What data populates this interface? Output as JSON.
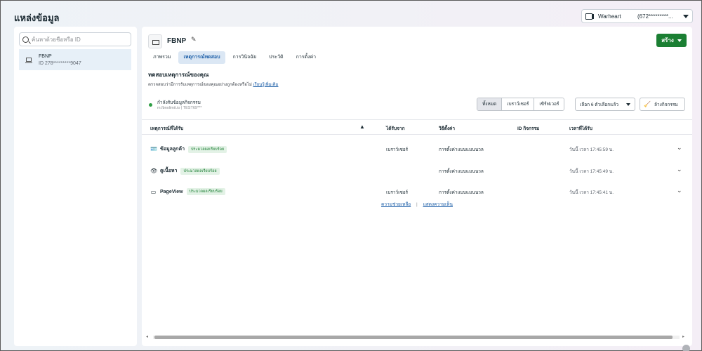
{
  "header": {
    "title": "แหล่งข้อมูล",
    "account": {
      "name": "Warheart",
      "id": "(672*********...",
      "icon": "business-account-icon"
    }
  },
  "sidebar": {
    "search_placeholder": "ค้นหาด้วยชื่อหรือ ID",
    "items": [
      {
        "name": "FBNP",
        "id": "ID 278*********9047",
        "icon": "monitor-icon"
      }
    ]
  },
  "main": {
    "source_name": "FBNP",
    "create_label": "สร้าง",
    "tabs": [
      {
        "label": "ภาพรวม",
        "active": false
      },
      {
        "label": "เหตุการณ์ทดสอบ",
        "active": true
      },
      {
        "label": "การวินิจฉัย",
        "active": false
      },
      {
        "label": "ประวัติ",
        "active": false
      },
      {
        "label": "การตั้งค่า",
        "active": false
      }
    ],
    "section_title": "ทดสอบเหตุการณ์ของคุณ",
    "section_desc": "ตรวจสอบว่ามีการรับเหตุการณ์ของคุณอย่างถูกต้องหรือไม่",
    "learn_more": "เรียนรู้เพิ่มเติม",
    "status_text": "กำลังรับข้อมูลกิจกรรม",
    "status_sub": "m.fbnolimit.io   |   TEST69***",
    "filters": [
      "ทั้งหมด",
      "เบราว์เซอร์",
      "เซิร์ฟเวอร์"
    ],
    "filter_selected": "เลือก 6 ตัวเลือกแล้ว",
    "clear_label": "ล้างกิจกรรม",
    "columns": [
      "เหตุการณ์ที่ได้รับ",
      "ได้รับจาก",
      "วิธีตั้งค่า",
      "ID กิจกรรม",
      "เวลาที่ได้รับ"
    ],
    "rows": [
      {
        "icon": "contact-card-icon",
        "event": "ข้อมูลลูกค้า",
        "badge": "ประมวลผลเรียบร้อย",
        "from": "เบราว์เซอร์",
        "method": "การตั้งค่าแบบแมนนวล",
        "time": "วันนี้ เวลา 17:45:59 น."
      },
      {
        "icon": "eye-icon",
        "event": "ดูเนื้อหา",
        "badge": "ประมวลผลเรียบร้อย",
        "from": "",
        "method": "การตั้งค่าแบบแมนนวล",
        "time": "วันนี้ เวลา 17:45:49 น."
      },
      {
        "icon": "page-icon",
        "event": "PageView",
        "badge": "ประมวลผลเรียบร้อย",
        "from": "เบราว์เซอร์",
        "method": "การตั้งค่าแบบแมนนวล",
        "time": "วันนี้ เวลา 17:45:41 น."
      }
    ],
    "help_link": "ความช่วยเหลือ",
    "feedback_link": "แสดงความเห็น"
  }
}
